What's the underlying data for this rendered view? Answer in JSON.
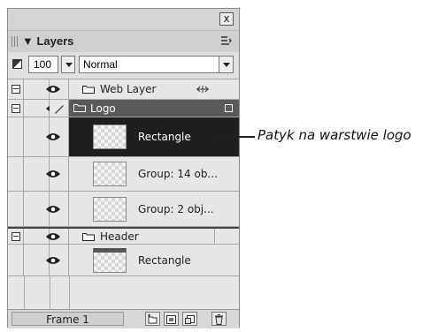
{
  "panel": {
    "close_label": "x",
    "title": "Layers",
    "menu_icon": "options-menu-icon"
  },
  "toolbar": {
    "opacity_value": "100",
    "blend_mode": "Normal"
  },
  "layers": [
    {
      "type": "layer",
      "label": "Web Layer",
      "expanded": true,
      "extra_icon": "web-layer-lock-icon"
    },
    {
      "type": "layer",
      "label": "Logo",
      "expanded": true,
      "active": true,
      "editing": true
    },
    {
      "type": "object",
      "label": "Rectangle",
      "selected": true
    },
    {
      "type": "object",
      "label": "Group: 14 ob..."
    },
    {
      "type": "object",
      "label": "Group: 2 obj..."
    },
    {
      "type": "layer",
      "label": "Header",
      "expanded": true
    },
    {
      "type": "object",
      "label": "Rectangle"
    }
  ],
  "footer": {
    "frame_label": "Frame 1",
    "buttons": [
      "new-sublayer-icon",
      "new-layer-icon",
      "duplicate-layer-icon",
      "trash-icon"
    ]
  },
  "annotation": {
    "text": "Patyk na warstwie logo"
  },
  "colors": {
    "selection": "#1f1f1f",
    "panel_bg": "#e3e3e3",
    "active_layer": "#5a5a5a"
  }
}
